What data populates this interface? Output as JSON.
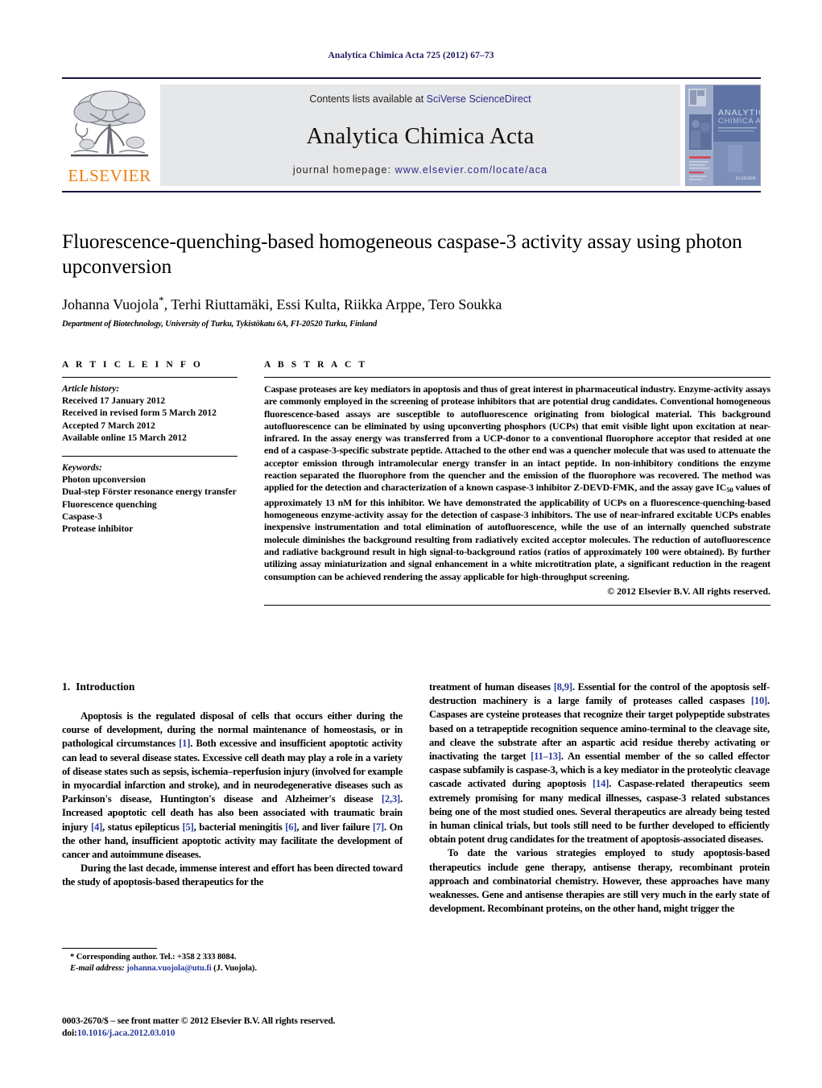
{
  "running_head": "Analytica Chimica Acta 725 (2012) 67–73",
  "masthead": {
    "publisher_name": "ELSEVIER",
    "contents_prefix": "Contents lists available at ",
    "contents_link": "SciVerse ScienceDirect",
    "journal_title": "Analytica Chimica Acta",
    "homepage_prefix": "journal homepage: ",
    "homepage_link": "www.elsevier.com/locate/aca",
    "cover_title_line1": "ANALYTICA",
    "cover_title_line2": "CHIMICA ACTA",
    "link_color": "#2a2a8c",
    "elsevier_orange": "#f07c10",
    "band_bg": "#e6e7e9"
  },
  "article": {
    "title": "Fluorescence-quenching-based homogeneous caspase-3 activity assay using photon upconversion",
    "authors": "Johanna Vuojola",
    "authors_rest": ", Terhi Riuttamäki, Essi Kulta, Riikka Arppe, Tero Soukka",
    "corresponding_marker": "*",
    "affiliation": "Department of Biotechnology, University of Turku, Tykistökatu 6A, FI-20520 Turku, Finland"
  },
  "article_info": {
    "heading": "A R T I C L E   I N F O",
    "history_label": "Article history:",
    "history": [
      "Received 17 January 2012",
      "Received in revised form 5 March 2012",
      "Accepted 7 March 2012",
      "Available online 15 March 2012"
    ],
    "keywords_label": "Keywords:",
    "keywords": [
      "Photon upconversion",
      "Dual-step Förster resonance energy transfer",
      "Fluorescence quenching",
      "Caspase-3",
      "Protease inhibitor"
    ]
  },
  "abstract": {
    "heading": "A B S T R A C T",
    "text": "Caspase proteases are key mediators in apoptosis and thus of great interest in pharmaceutical industry. Enzyme-activity assays are commonly employed in the screening of protease inhibitors that are potential drug candidates. Conventional homogeneous fluorescence-based assays are susceptible to autofluorescence originating from biological material. This background autofluorescence can be eliminated by using upconverting phosphors (UCPs) that emit visible light upon excitation at near-infrared. In the assay energy was transferred from a UCP-donor to a conventional fluorophore acceptor that resided at one end of a caspase-3-specific substrate peptide. Attached to the other end was a quencher molecule that was used to attenuate the acceptor emission through intramolecular energy transfer in an intact peptide. In non-inhibitory conditions the enzyme reaction separated the fluorophore from the quencher and the emission of the fluorophore was recovered. The method was applied for the detection and characterization of a known caspase-3 inhibitor Z-DEVD-FMK, and the assay gave IC50 values of approximately 13 nM for this inhibitor. We have demonstrated the applicability of UCPs on a fluorescence-quenching-based homogeneous enzyme-activity assay for the detection of caspase-3 inhibitors. The use of near-infrared excitable UCPs enables inexpensive instrumentation and total elimination of autofluorescence, while the use of an internally quenched substrate molecule diminishes the background resulting from radiatively excited acceptor molecules. The reduction of autofluorescence and radiative background result in high signal-to-background ratios (ratios of approximately 100 were obtained). By further utilizing assay miniaturization and signal enhancement in a white microtitration plate, a significant reduction in the reagent consumption can be achieved rendering the assay applicable for high-throughput screening.",
    "copyright": "© 2012 Elsevier B.V. All rights reserved."
  },
  "introduction": {
    "number": "1.",
    "title": "Introduction",
    "left_para_1": "Apoptosis is the regulated disposal of cells that occurs either during the course of development, during the normal maintenance of homeostasis, or in pathological circumstances [1]. Both excessive and insufficient apoptotic activity can lead to several disease states. Excessive cell death may play a role in a variety of disease states such as sepsis, ischemia–reperfusion injury (involved for example in myocardial infarction and stroke), and in neurodegenerative diseases such as Parkinson's disease, Huntington's disease and Alzheimer's disease [2,3]. Increased apoptotic cell death has also been associated with traumatic brain injury [4], status epilepticus [5], bacterial meningitis [6], and liver failure [7]. On the other hand, insufficient apoptotic activity may facilitate the development of cancer and autoimmune diseases.",
    "left_para_2": "During the last decade, immense interest and effort has been directed toward the study of apoptosis-based therapeutics for the",
    "right_para_1": "treatment of human diseases [8,9]. Essential for the control of the apoptosis self-destruction machinery is a large family of proteases called caspases [10]. Caspases are cysteine proteases that recognize their target polypeptide substrates based on a tetrapeptide recognition sequence amino-terminal to the cleavage site, and cleave the substrate after an aspartic acid residue thereby activating or inactivating the target [11–13]. An essential member of the so called effector caspase subfamily is caspase-3, which is a key mediator in the proteolytic cleavage cascade activated during apoptosis [14]. Caspase-related therapeutics seem extremely promising for many medical illnesses, caspase-3 related substances being one of the most studied ones. Several therapeutics are already being tested in human clinical trials, but tools still need to be further developed to efficiently obtain potent drug candidates for the treatment of apoptosis-associated diseases.",
    "right_para_2": "To date the various strategies employed to study apoptosis-based therapeutics include gene therapy, antisense therapy, recombinant protein approach and combinatorial chemistry. However, these approaches have many weaknesses. Gene and antisense therapies are still very much in the early state of development. Recombinant proteins, on the other hand, might trigger the"
  },
  "footnotes": {
    "corresponding": "* Corresponding author. Tel.: +358 2 333 8084.",
    "email_label": "E-mail address:",
    "email_link": "johanna.vuojola@utu.fi",
    "email_suffix": " (J. Vuojola)."
  },
  "footer": {
    "front_matter": "0003-2670/$ – see front matter © 2012 Elsevier B.V. All rights reserved.",
    "doi_label": "doi:",
    "doi_value": "10.1016/j.aca.2012.03.010"
  }
}
